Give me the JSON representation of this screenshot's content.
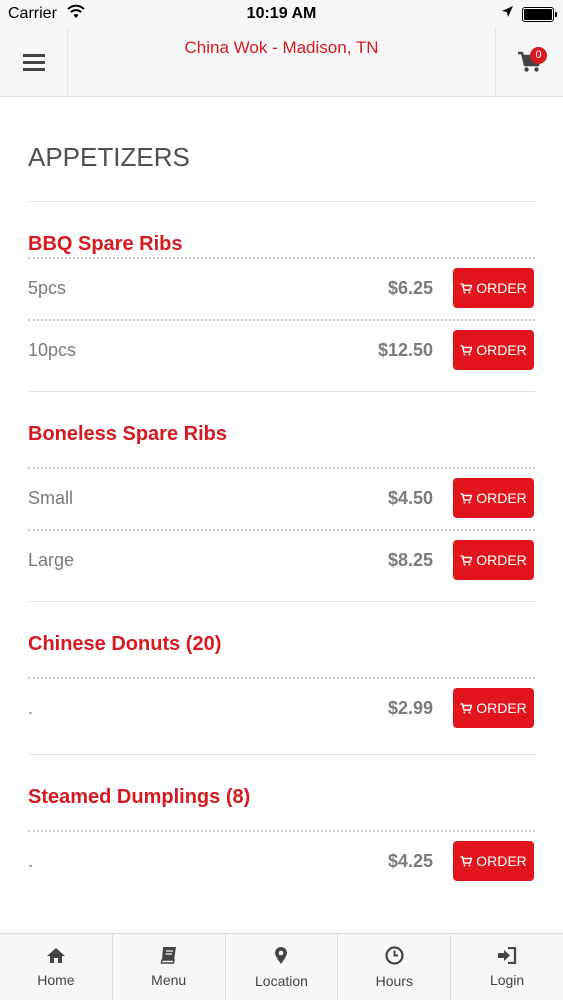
{
  "status_bar": {
    "carrier": "Carrier",
    "time": "10:19 AM"
  },
  "header": {
    "title": "China Wok - Madison, TN",
    "cart_count": "0",
    "accent": "#d71920"
  },
  "section": {
    "title": "APPETIZERS"
  },
  "items": [
    {
      "name": "BBQ Spare Ribs",
      "options": [
        {
          "size": "5pcs",
          "price": "$6.25",
          "order": "ORDER"
        },
        {
          "size": "10pcs",
          "price": "$12.50",
          "order": "ORDER"
        }
      ]
    },
    {
      "name": "Boneless Spare Ribs",
      "options": [
        {
          "size": "Small",
          "price": "$4.50",
          "order": "ORDER"
        },
        {
          "size": "Large",
          "price": "$8.25",
          "order": "ORDER"
        }
      ]
    },
    {
      "name": "Chinese Donuts (20)",
      "options": [
        {
          "size": ".",
          "price": "$2.99",
          "order": "ORDER"
        }
      ]
    },
    {
      "name": "Steamed Dumplings (8)",
      "options": [
        {
          "size": ".",
          "price": "$4.25",
          "order": "ORDER"
        }
      ]
    }
  ],
  "tabbar": [
    {
      "label": "Home",
      "icon": "home-icon"
    },
    {
      "label": "Menu",
      "icon": "book-icon"
    },
    {
      "label": "Location",
      "icon": "map-pin-icon"
    },
    {
      "label": "Hours",
      "icon": "clock-icon"
    },
    {
      "label": "Login",
      "icon": "login-icon"
    }
  ]
}
